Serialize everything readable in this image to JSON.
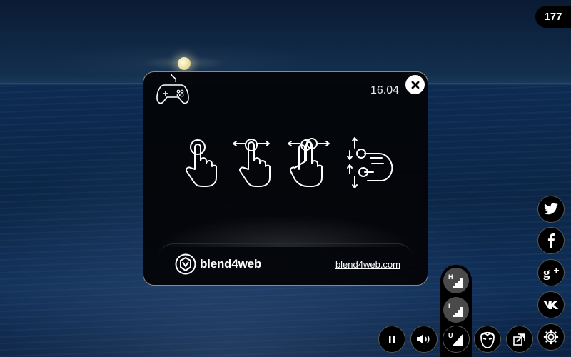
{
  "fps": "177",
  "dialog": {
    "version": "16.04",
    "brand": "blend4web",
    "link_text": "blend4web.com",
    "gestures": [
      "tap-gesture-icon",
      "swipe-gesture-icon",
      "two-finger-swipe-icon",
      "pinch-zoom-gesture-icon"
    ]
  },
  "social": [
    "twitter-icon",
    "facebook-icon",
    "google-plus-icon",
    "vk-icon",
    "settings-gear-icon"
  ],
  "controls": {
    "quality_high": "H",
    "quality_low": "L",
    "quality_ultra": "U",
    "pause_label": "II"
  },
  "colors": {
    "panel": "#000000",
    "border": "#555555",
    "accent": "#ffffff"
  }
}
